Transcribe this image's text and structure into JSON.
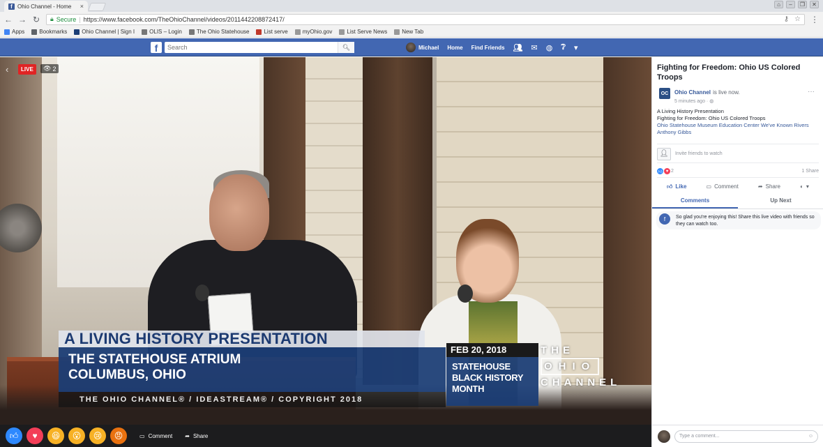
{
  "browser": {
    "tab_title": "Ohio Channel - Home",
    "tab_close": "×",
    "window_buttons": [
      "⌂",
      "–",
      "❐",
      "✕"
    ],
    "secure_label": "Secure",
    "url": "https://www.facebook.com/TheOhioChannel/videos/2011442208872417/",
    "bookmarks": [
      {
        "label": "Apps",
        "color": "#4285f4"
      },
      {
        "label": "Bookmarks",
        "color": "#5f6368"
      },
      {
        "label": "Ohio Channel | Sign I",
        "color": "#1c3e76"
      },
      {
        "label": "OLIS – Login",
        "color": "#777777"
      },
      {
        "label": "The Ohio Statehouse",
        "color": "#777777"
      },
      {
        "label": "List serve",
        "color": "#c0392b"
      },
      {
        "label": "myOhio.gov",
        "color": "#999999"
      },
      {
        "label": "List Serve News",
        "color": "#999999"
      },
      {
        "label": "New Tab",
        "color": "#999999"
      }
    ]
  },
  "facebook": {
    "logo": "f",
    "search_placeholder": "Search",
    "profile_name": "Michael",
    "nav": [
      "Home",
      "Find Friends"
    ]
  },
  "video": {
    "live_label": "LIVE",
    "viewers": "2",
    "lower_third": {
      "headline": "A LIVING HISTORY PRESENTATION",
      "line1": "THE STATEHOUSE ATRIUM",
      "line2": "COLUMBUS, OHIO",
      "credits": "THE OHIO CHANNEL® / IDEASTREAM® / COPYRIGHT 2018",
      "date": "FEB 20, 2018",
      "event_line1": "STATEHOUSE",
      "event_line2": "BLACK HISTORY",
      "event_line3": "MONTH",
      "logo_top": "THE",
      "logo_mid": "OHIO",
      "logo_bot": "CHANNEL"
    },
    "controls": {
      "comment_label": "Comment",
      "share_label": "Share"
    }
  },
  "sidebar": {
    "title": "Fighting for Freedom: Ohio US Colored Troops",
    "page_name": "Ohio Channel",
    "page_status": "is live now.",
    "time": "5 minutes ago · ",
    "desc_line1": "A Living History Presentation",
    "desc_line2": "Fighting for Freedom: Ohio US Colored Troops",
    "desc_link": "Ohio Statehouse Museum Education Center We've Known Rivers",
    "desc_link2": "Anthony Gibbs",
    "invite_label": "Invite friends to watch",
    "reaction_count": "2",
    "share_count": "1 Share",
    "like_label": "Like",
    "comment_label": "Comment",
    "share_label": "Share",
    "tab_comments": "Comments",
    "tab_upnext": "Up Next",
    "notice_text": "So glad you're enjoying this! Share this live video with friends so they can watch too.",
    "composer_placeholder": "Type a comment..."
  }
}
